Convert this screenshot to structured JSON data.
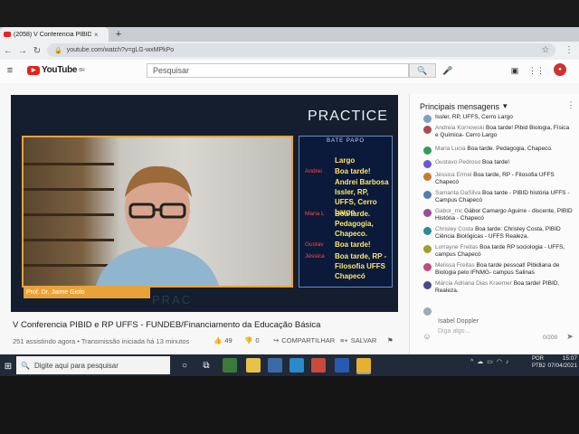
{
  "browser": {
    "tab_title": "(2058) V Conferencia PIBID e",
    "tab_close": "×",
    "new_tab": "+",
    "url": "youtube.com/watch?v=gLG-wxMPkPo"
  },
  "youtube": {
    "logo_text": "YouTube",
    "logo_region": "BR",
    "search_placeholder": "Pesquisar"
  },
  "video": {
    "brand": "PRACTICE",
    "overlay_chat_header": "BATE PAPO",
    "overlay_chat": [
      {
        "name": "",
        "text": "Largo"
      },
      {
        "name": "Andrei",
        "text": "Boa tarde!"
      },
      {
        "name": "",
        "text": "Andrei Barbosa Issler, RP, UFFS, Cerro Largo"
      },
      {
        "name": "Maria L",
        "text": "Boa tarde. Pedagogia, Chapeco."
      },
      {
        "name": "Gustav",
        "text": "Boa tarde!"
      },
      {
        "name": "Jéssica",
        "text": "Boa tarde, RP - Filosofia UFFS Chapecó"
      }
    ],
    "speaker_caption": "Prof. Dr. Jaime Giolo",
    "watermark": "PRAC",
    "title": "V Conferencia PIBID e RP UFFS - FUNDEB/Financiamento da Educação Básica",
    "views": "251 assistindo agora • Transmissão iniciada há 13 minutos",
    "likes": "49",
    "dislikes": "0",
    "share": "COMPARTILHAR",
    "save": "SALVAR"
  },
  "chat_panel": {
    "header": "Principais mensagens",
    "messages": [
      {
        "author": "",
        "text": "Issler, RP, UFFS, Cerro Largo",
        "color": "#7aa0c8"
      },
      {
        "author": "Andreia Kornowski",
        "text": "Boa tarde! Pibid Biologia, Física e Química- Cerro Largo",
        "color": "#b04a4a"
      },
      {
        "author": "Maria Lucia",
        "text": "Boa tarde. Pedagogia, Chapeco.",
        "color": "#3a9a5a"
      },
      {
        "author": "Gustavo Pedroso",
        "text": "Boa tarde!",
        "color": "#6a5acd"
      },
      {
        "author": "Jéssica Ermel",
        "text": "Boa tarde, RP - Filosofia UFFS Chapecó",
        "color": "#c77a2a"
      },
      {
        "author": "Samanta DaSilva",
        "text": "Boa tarde - PIBID história UFFS - Campus Chapecó",
        "color": "#5a7ab0"
      },
      {
        "author": "Gabor_mc",
        "text": "Gábor Camargo Aguirre - discente, PIBID História - Chapecó",
        "color": "#9a4a9a"
      },
      {
        "author": "Chrisley Costa",
        "text": "Boa tarde: Chrisley Costa, PIBID Ciência Biológicas - UFFS Realeza.",
        "color": "#2a8aa0"
      },
      {
        "author": "Lorrayne Freitas",
        "text": "Boa tarde RP sociologia - UFFS, campus Chapecó",
        "color": "#a0a02a"
      },
      {
        "author": "Melissa Freitas",
        "text": "Boa tarde pessoal! Pibidiana de Biologia pelo IFNMG- campus Salinas",
        "color": "#c04a7a"
      },
      {
        "author": "Márcia Adriana Dias Kraemer",
        "text": "Boa tarde! PIBID, Realeza.",
        "color": "#4a4a8a"
      }
    ],
    "input_user": "Isabel Doppler",
    "input_placeholder": "Diga algo...",
    "counter": "0/200"
  },
  "taskbar": {
    "search_placeholder": "Digite aqui para pesquisar",
    "lang_line1": "POR",
    "lang_line2": "PTB2",
    "time": "15:07",
    "date": "07/04/2021"
  }
}
